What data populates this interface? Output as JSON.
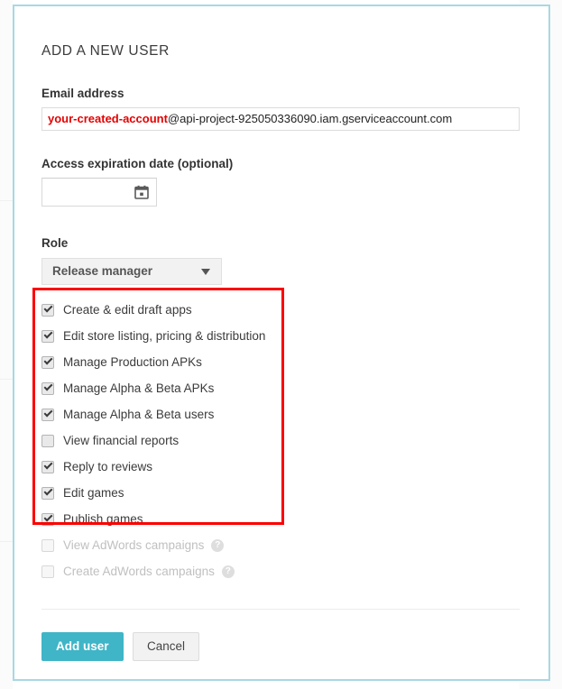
{
  "card": {
    "section_title": "ADD A NEW USER",
    "email": {
      "label": "Email address",
      "value_user": "your-created-account",
      "value_domain": "@api-project-925050336090.iam.gserviceaccount.com",
      "placeholder": ""
    },
    "expiration": {
      "label": "Access expiration date (optional)",
      "value": "",
      "placeholder": "",
      "icon": "calendar-icon"
    },
    "role": {
      "label": "Role",
      "selected": "Release manager",
      "icon": "chevron-down-icon"
    },
    "permissions": [
      {
        "label": "Create & edit draft apps",
        "checked": true,
        "disabled": false,
        "help": false
      },
      {
        "label": "Edit store listing, pricing & distribution",
        "checked": true,
        "disabled": false,
        "help": false
      },
      {
        "label": "Manage Production APKs",
        "checked": true,
        "disabled": false,
        "help": false
      },
      {
        "label": "Manage Alpha & Beta APKs",
        "checked": true,
        "disabled": false,
        "help": false
      },
      {
        "label": "Manage Alpha & Beta users",
        "checked": true,
        "disabled": false,
        "help": false
      },
      {
        "label": "View financial reports",
        "checked": false,
        "disabled": false,
        "help": false
      },
      {
        "label": "Reply to reviews",
        "checked": true,
        "disabled": false,
        "help": false
      },
      {
        "label": "Edit games",
        "checked": true,
        "disabled": false,
        "help": false
      },
      {
        "label": "Publish games",
        "checked": true,
        "disabled": false,
        "help": false
      },
      {
        "label": "View AdWords campaigns",
        "checked": false,
        "disabled": true,
        "help": true,
        "help_glyph": "?"
      },
      {
        "label": "Create AdWords campaigns",
        "checked": false,
        "disabled": true,
        "help": true,
        "help_glyph": "?"
      }
    ],
    "buttons": {
      "submit": "Add user",
      "cancel": "Cancel"
    }
  },
  "annotation": {
    "type": "highlight-rectangle",
    "color": "#fb0000"
  },
  "colors": {
    "accent_teal": "#3fb5c7",
    "highlight_red": "#fb0000",
    "card_border_cyan": "#a8d8e4",
    "email_user_red": "#e60000"
  }
}
